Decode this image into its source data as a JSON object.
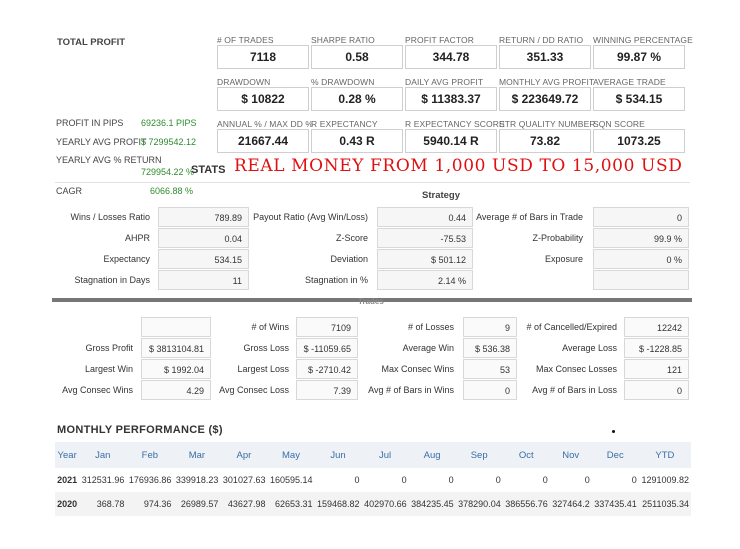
{
  "total_profit_label": "TOTAL PROFIT",
  "metrics_row1": [
    {
      "label": "# OF TRADES",
      "value": "7118"
    },
    {
      "label": "SHARPE RATIO",
      "value": "0.58"
    },
    {
      "label": "PROFIT FACTOR",
      "value": "344.78"
    },
    {
      "label": "RETURN / DD RATIO",
      "value": "351.33"
    },
    {
      "label": "WINNING PERCENTAGE",
      "value": "99.87 %"
    }
  ],
  "metrics_row2": [
    {
      "label": "DRAWDOWN",
      "value": "$ 10822"
    },
    {
      "label": "% DRAWDOWN",
      "value": "0.28 %"
    },
    {
      "label": "DAILY AVG PROFIT",
      "value": "$ 11383.37"
    },
    {
      "label": "MONTHLY AVG PROFIT",
      "value": "$ 223649.72"
    },
    {
      "label": "AVERAGE TRADE",
      "value": "$ 534.15"
    }
  ],
  "metrics_row3": [
    {
      "label": "ANNUAL % / MAX DD %",
      "value": "21667.44"
    },
    {
      "label": "R EXPECTANCY",
      "value": "0.43 R"
    },
    {
      "label": "R EXPECTANCY SCORE",
      "value": "5940.14 R"
    },
    {
      "label": "STR QUALITY NUMBER",
      "value": "73.82"
    },
    {
      "label": "SQN SCORE",
      "value": "1073.25"
    }
  ],
  "side": {
    "profit_pips_label": "PROFIT IN PIPS",
    "profit_pips_value": "69236.1 PIPS",
    "yearly_avg_profit_label": "YEARLY AVG PROFIT",
    "yearly_avg_profit_value": "$ 7299542.12",
    "yearly_avg_return_label": "YEARLY AVG % RETURN",
    "yearly_avg_return_value": "729954.22 %",
    "stats_label": "STATS",
    "cagr_label": "CAGR",
    "cagr_value": "6066.88 %"
  },
  "banner": "REAL MONEY FROM 1,000 USD TO 15,000 USD",
  "strategy": {
    "title": "Strategy",
    "rows": [
      [
        {
          "label": "Wins / Losses Ratio",
          "value": "789.89"
        },
        {
          "label": "Payout Ratio (Avg Win/Loss)",
          "value": "0.44"
        },
        {
          "label": "Average # of Bars in Trade",
          "value": "0"
        }
      ],
      [
        {
          "label": "AHPR",
          "value": "0.04"
        },
        {
          "label": "Z-Score",
          "value": "-75.53"
        },
        {
          "label": "Z-Probability",
          "value": "99.9 %"
        }
      ],
      [
        {
          "label": "Expectancy",
          "value": "534.15"
        },
        {
          "label": "Deviation",
          "value": "$ 501.12"
        },
        {
          "label": "Exposure",
          "value": "0 %"
        }
      ],
      [
        {
          "label": "Stagnation in Days",
          "value": "11"
        },
        {
          "label": "Stagnation in %",
          "value": "2.14 %"
        },
        {
          "label": "",
          "value": ""
        }
      ]
    ]
  },
  "trades": {
    "title": "Trades",
    "rows": [
      [
        {
          "label": "",
          "value": ""
        },
        {
          "label": "# of Wins",
          "value": "7109"
        },
        {
          "label": "# of Losses",
          "value": "9"
        },
        {
          "label": "# of Cancelled/Expired",
          "value": "12242"
        }
      ],
      [
        {
          "label": "Gross Profit",
          "value": "$ 3813104.81"
        },
        {
          "label": "Gross Loss",
          "value": "$ -11059.65"
        },
        {
          "label": "Average Win",
          "value": "$ 536.38"
        },
        {
          "label": "Average Loss",
          "value": "$ -1228.85"
        }
      ],
      [
        {
          "label": "Largest Win",
          "value": "$ 1992.04"
        },
        {
          "label": "Largest Loss",
          "value": "$ -2710.42"
        },
        {
          "label": "Max Consec Wins",
          "value": "53"
        },
        {
          "label": "Max Consec Losses",
          "value": "121"
        }
      ],
      [
        {
          "label": "Avg Consec Wins",
          "value": "4.29"
        },
        {
          "label": "Avg Consec Loss",
          "value": "7.39"
        },
        {
          "label": "Avg # of Bars in Wins",
          "value": "0"
        },
        {
          "label": "Avg # of Bars in Loss",
          "value": "0"
        }
      ]
    ]
  },
  "monthly": {
    "title": "MONTHLY PERFORMANCE ($)",
    "headers": [
      "Year",
      "Jan",
      "Feb",
      "Mar",
      "Apr",
      "May",
      "Jun",
      "Jul",
      "Aug",
      "Sep",
      "Oct",
      "Nov",
      "Dec",
      "YTD"
    ],
    "rows": [
      [
        "2021",
        "312531.96",
        "176936.86",
        "339918.23",
        "301027.63",
        "160595.14",
        "0",
        "0",
        "0",
        "0",
        "0",
        "0",
        "0",
        "1291009.82"
      ],
      [
        "2020",
        "368.78",
        "974.36",
        "26989.57",
        "43627.98",
        "62653.31",
        "159468.82",
        "402970.66",
        "384235.45",
        "378290.04",
        "386556.76",
        "327464.2",
        "337435.41",
        "2511035.34"
      ]
    ]
  }
}
